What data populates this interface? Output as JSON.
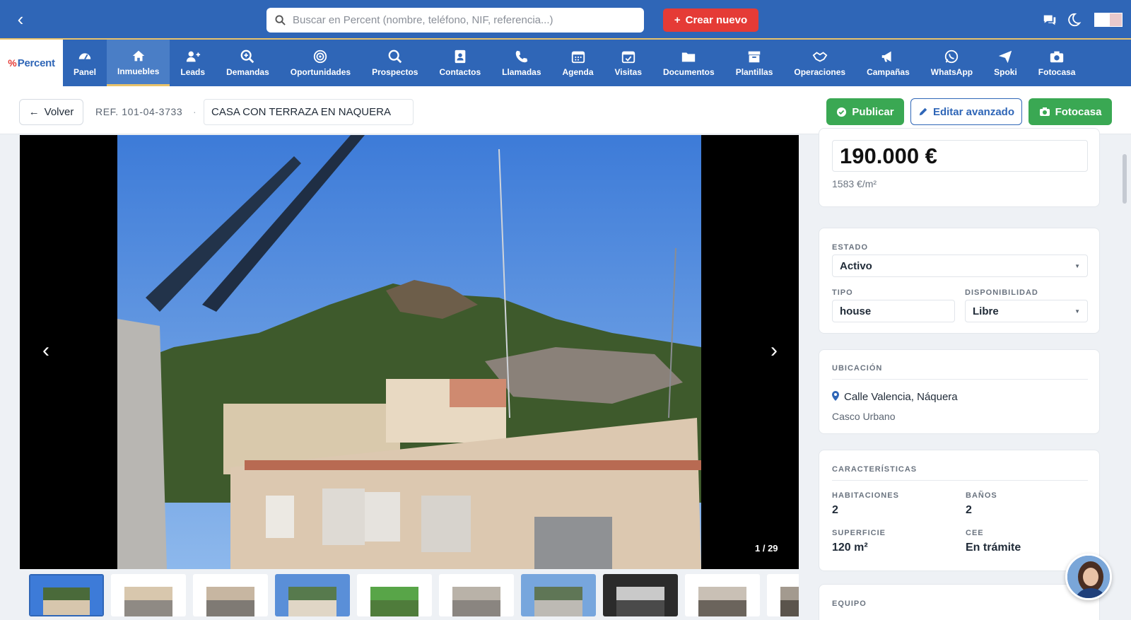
{
  "search": {
    "placeholder": "Buscar en Percent (nombre, teléfono, NIF, referencia...)"
  },
  "topbar": {
    "create_label": "Crear nuevo",
    "icons": [
      "back-chevron-icon",
      "search-icon",
      "chat-icon",
      "moon-icon"
    ]
  },
  "brand": {
    "name": "Percent",
    "mark": "%"
  },
  "nav": {
    "items": [
      {
        "label": "Panel",
        "icon": "dashboard-icon"
      },
      {
        "label": "Inmuebles",
        "icon": "home-icon",
        "active": true
      },
      {
        "label": "Leads",
        "icon": "add-user-icon"
      },
      {
        "label": "Demandas",
        "icon": "search-plus-icon"
      },
      {
        "label": "Oportunidades",
        "icon": "target-icon"
      },
      {
        "label": "Prospectos",
        "icon": "search-icon"
      },
      {
        "label": "Contactos",
        "icon": "contact-card-icon"
      },
      {
        "label": "Llamadas",
        "icon": "phone-icon"
      },
      {
        "label": "Agenda",
        "icon": "calendar-icon"
      },
      {
        "label": "Visitas",
        "icon": "calendar-check-icon"
      },
      {
        "label": "Documentos",
        "icon": "folder-icon"
      },
      {
        "label": "Plantillas",
        "icon": "archive-icon"
      },
      {
        "label": "Operaciones",
        "icon": "handshake-icon"
      },
      {
        "label": "Campañas",
        "icon": "megaphone-icon"
      },
      {
        "label": "WhatsApp",
        "icon": "whatsapp-icon"
      },
      {
        "label": "Spoki",
        "icon": "paper-plane-icon"
      },
      {
        "label": "Fotocasa",
        "icon": "camera-icon"
      }
    ]
  },
  "actionbar": {
    "back_label": "Volver",
    "ref": "REF. 101-04-3733",
    "separator": "·",
    "title": "CASA CON TERRAZA EN NAQUERA",
    "publish_label": "Publicar",
    "edit_label": "Editar avanzado",
    "fotocasa_label": "Fotocasa"
  },
  "gallery": {
    "counter": "1 / 29",
    "thumb_count": 10
  },
  "price": {
    "value": "190.000 €",
    "per_m2": "1583 €/m²"
  },
  "status": {
    "estado_label": "ESTADO",
    "estado_value": "Activo",
    "tipo_label": "TIPO",
    "tipo_value": "house",
    "disponibilidad_label": "DISPONIBILIDAD",
    "disponibilidad_value": "Libre"
  },
  "location": {
    "heading": "UBICACIÓN",
    "address": "Calle Valencia, Náquera",
    "zone": "Casco Urbano"
  },
  "features": {
    "heading": "CARACTERÍSTICAS",
    "habitaciones_label": "HABITACIONES",
    "habitaciones_value": "2",
    "banos_label": "BAÑOS",
    "banos_value": "2",
    "superficie_label": "SUPERFICIE",
    "superficie_value": "120 m²",
    "cee_label": "CEE",
    "cee_value": "En trámite"
  },
  "team": {
    "heading": "EQUIPO"
  },
  "colors": {
    "brand_blue": "#2f66b7",
    "accent_red": "#e53b36",
    "success_green": "#3aa853",
    "nav_gold": "#e8c26a"
  }
}
